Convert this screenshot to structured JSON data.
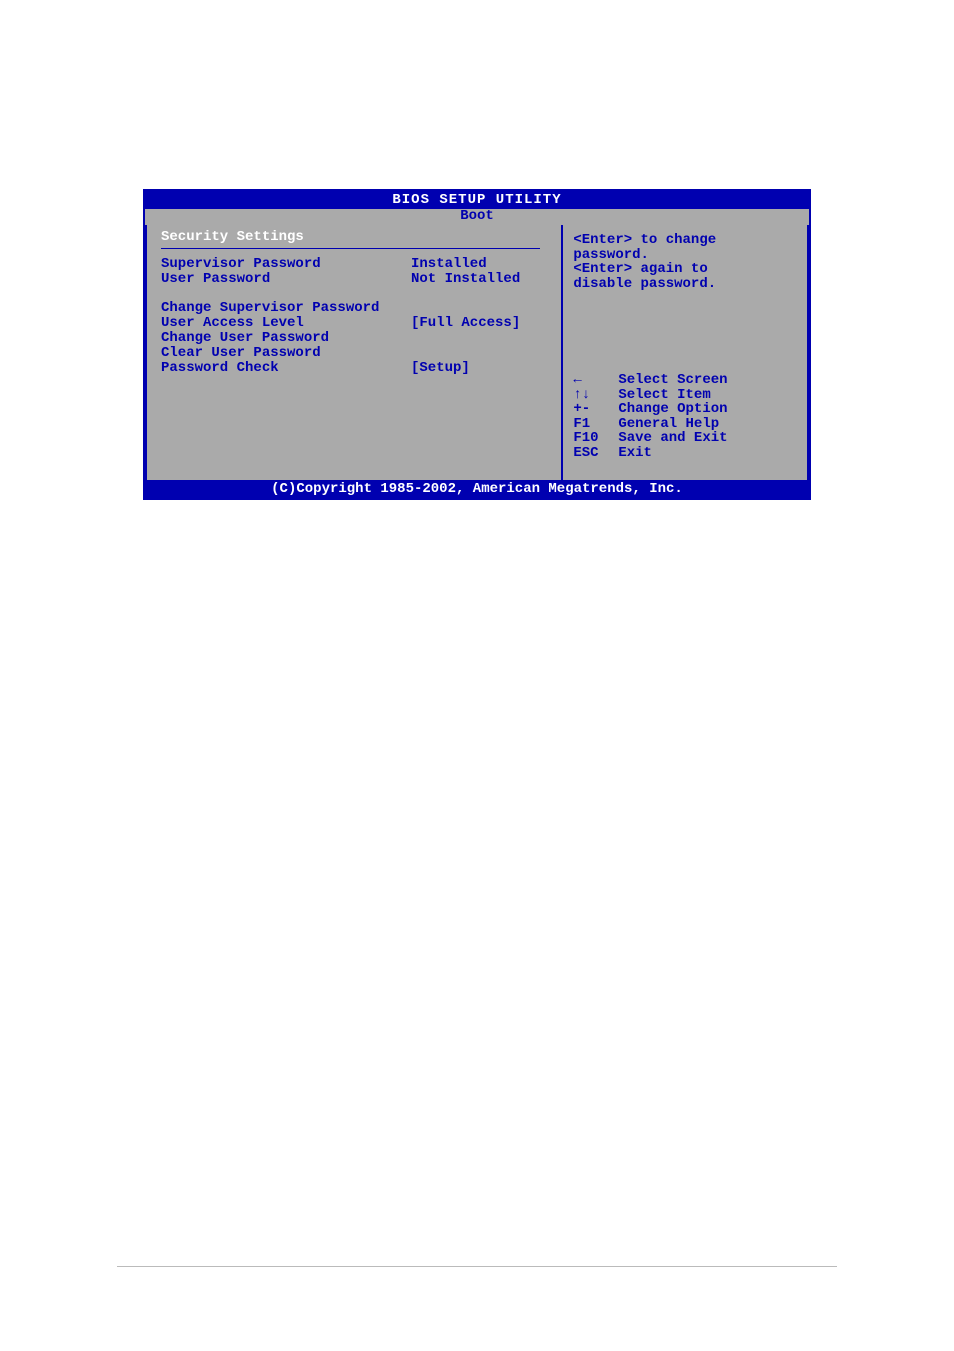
{
  "title": "BIOS SETUP UTILITY",
  "tab": "Boot",
  "section_header": "Security Settings",
  "status": {
    "supervisor_password": {
      "label": "Supervisor Password",
      "value": "Installed"
    },
    "user_password": {
      "label": "User Password",
      "value": "Not Installed"
    }
  },
  "items": {
    "change_supervisor_password": {
      "label": "Change Supervisor Password",
      "value": ""
    },
    "user_access_level": {
      "label": "User Access Level",
      "value": "[Full Access]"
    },
    "change_user_password": {
      "label": "Change User Password",
      "value": ""
    },
    "clear_user_password": {
      "label": "Clear User Password",
      "value": ""
    },
    "password_check": {
      "label": "Password Check",
      "value": "[Setup]"
    }
  },
  "help": {
    "line1": "<Enter> to change",
    "line2": "password.",
    "line3": "<Enter> again to",
    "line4": "disable password."
  },
  "keyhelp": {
    "select_screen": {
      "key": "←",
      "desc": "Select Screen"
    },
    "select_item": {
      "key": "↑↓",
      "desc": "Select Item"
    },
    "change_option": {
      "key": "+-",
      "desc": "Change Option"
    },
    "general_help": {
      "key": "F1",
      "desc": "General Help"
    },
    "save_exit": {
      "key": "F10",
      "desc": "Save and Exit"
    },
    "exit": {
      "key": "ESC",
      "desc": "Exit"
    }
  },
  "footer": "(C)Copyright 1985-2002, American Megatrends, Inc."
}
